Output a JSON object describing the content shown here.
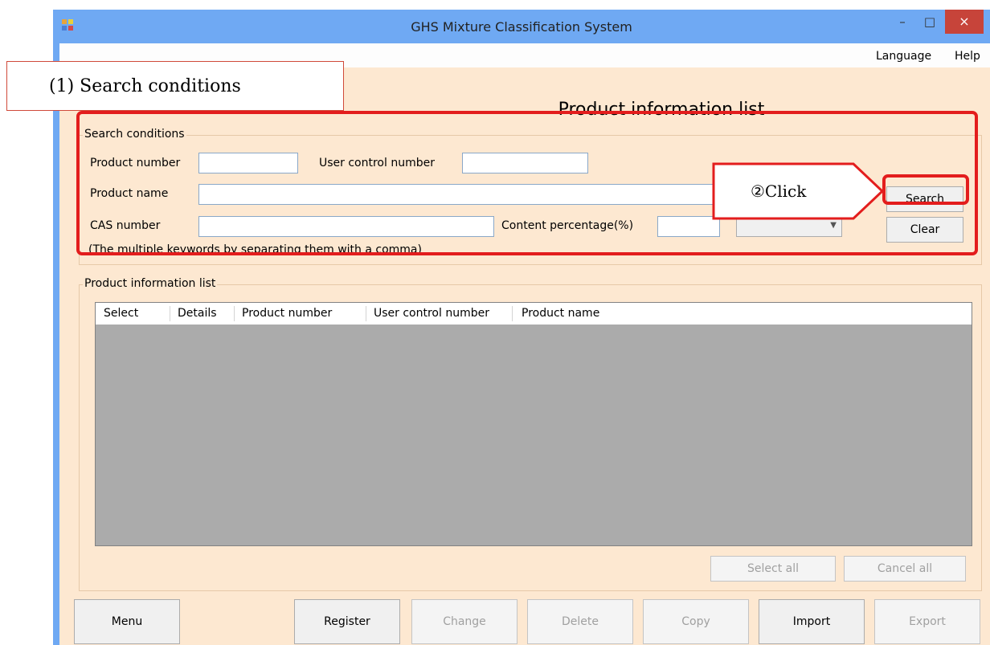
{
  "window": {
    "title": "GHS Mixture Classification System"
  },
  "titlebar": {
    "minimize": "–",
    "maximize": "□",
    "close": "×"
  },
  "menu": {
    "language": "Language",
    "help": "Help"
  },
  "page_title": "Product information list",
  "search": {
    "group_label": "Search conditions",
    "product_number_label": "Product number",
    "product_number_value": "",
    "user_control_label": "User control number",
    "user_control_value": "",
    "product_name_label": "Product name",
    "product_name_value": "",
    "cas_label": "CAS number",
    "cas_value": "",
    "content_label": "Content percentage(%)",
    "content_value": "",
    "hint": "(The multiple keywords by separating them with a comma)",
    "search_button": "Search",
    "clear_button": "Clear"
  },
  "list": {
    "group_label": "Product information list",
    "columns": [
      "Select",
      "Details",
      "Product number",
      "User control number",
      "Product name"
    ],
    "select_all": "Select all",
    "cancel_all": "Cancel all"
  },
  "bottom_buttons": {
    "menu": "Menu",
    "register": "Register",
    "change": "Change",
    "delete": "Delete",
    "copy": "Copy",
    "import": "Import",
    "export": "Export"
  },
  "annotations": {
    "callout1": "(1) Search conditions",
    "callout2": "②Click"
  },
  "colors": {
    "titlebar": "#6fa9f3",
    "client": "#fde8d1",
    "close": "#c7443a",
    "highlight": "#e31d1d",
    "grid": "#ababab"
  }
}
